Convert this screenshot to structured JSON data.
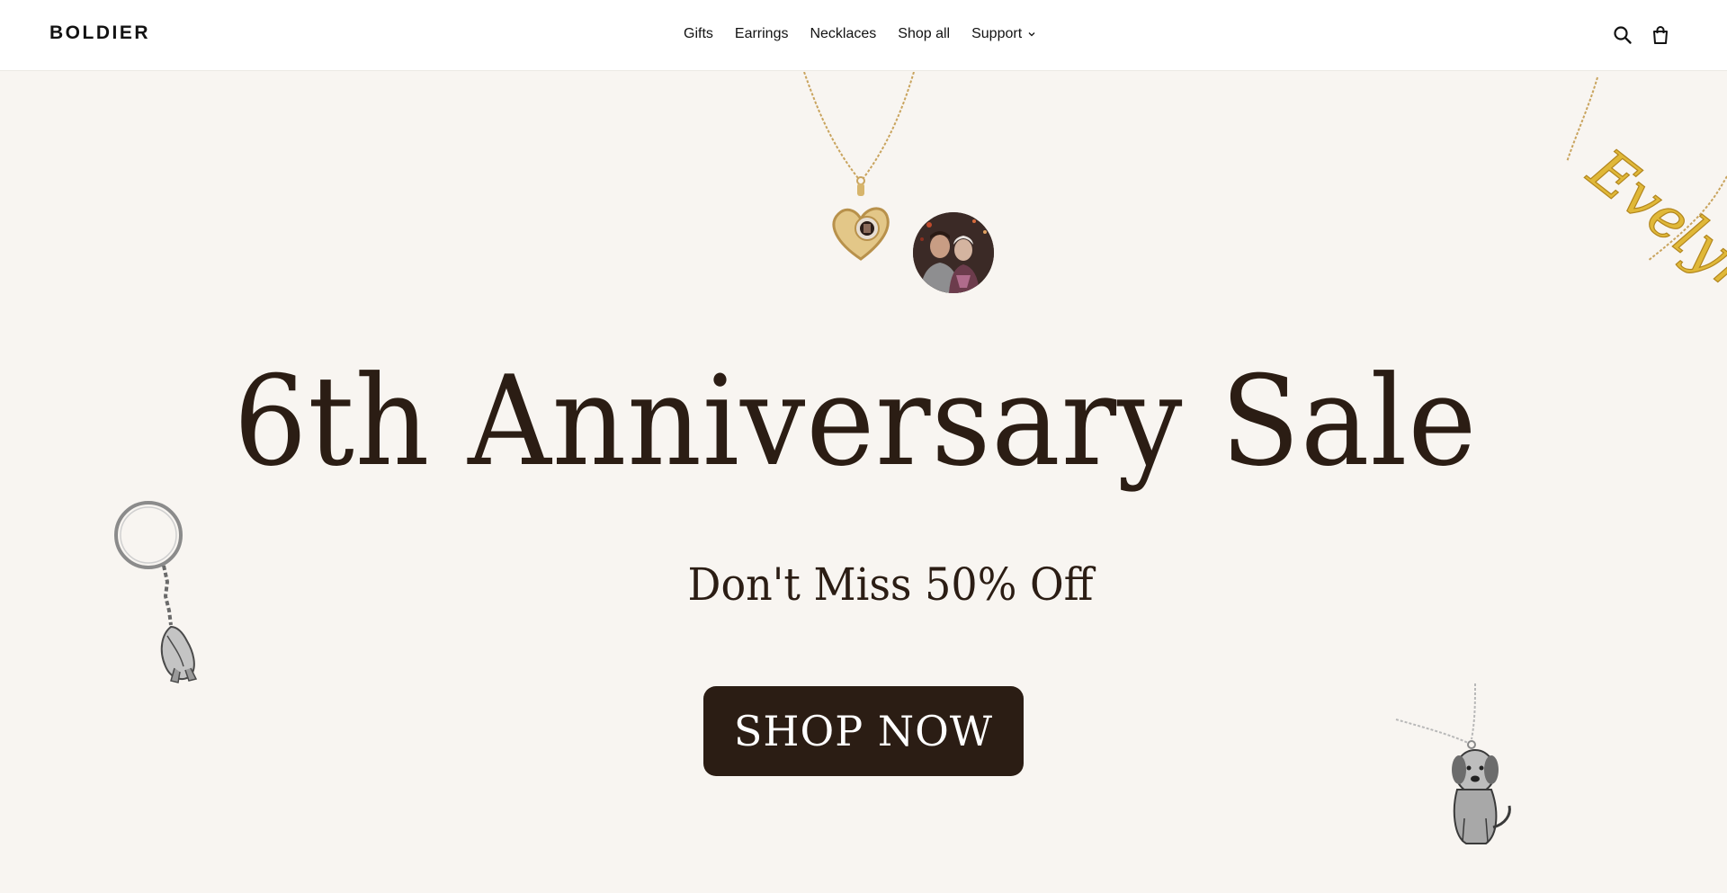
{
  "header": {
    "logo": "BOLDIER",
    "nav": [
      {
        "label": "Gifts"
      },
      {
        "label": "Earrings"
      },
      {
        "label": "Necklaces"
      },
      {
        "label": "Shop all"
      },
      {
        "label": "Support",
        "has_dropdown": true
      }
    ],
    "icons": [
      "search-icon",
      "cart-icon"
    ]
  },
  "hero": {
    "title": "6th Anniversary Sale",
    "subtitle": "Don't Miss 50% Off",
    "cta_label": "SHOP NOW",
    "background_color": "#f8f5f1",
    "text_color": "#2b1d14",
    "button_color": "#2b1d14",
    "name_necklace_text": "Evelyn"
  }
}
